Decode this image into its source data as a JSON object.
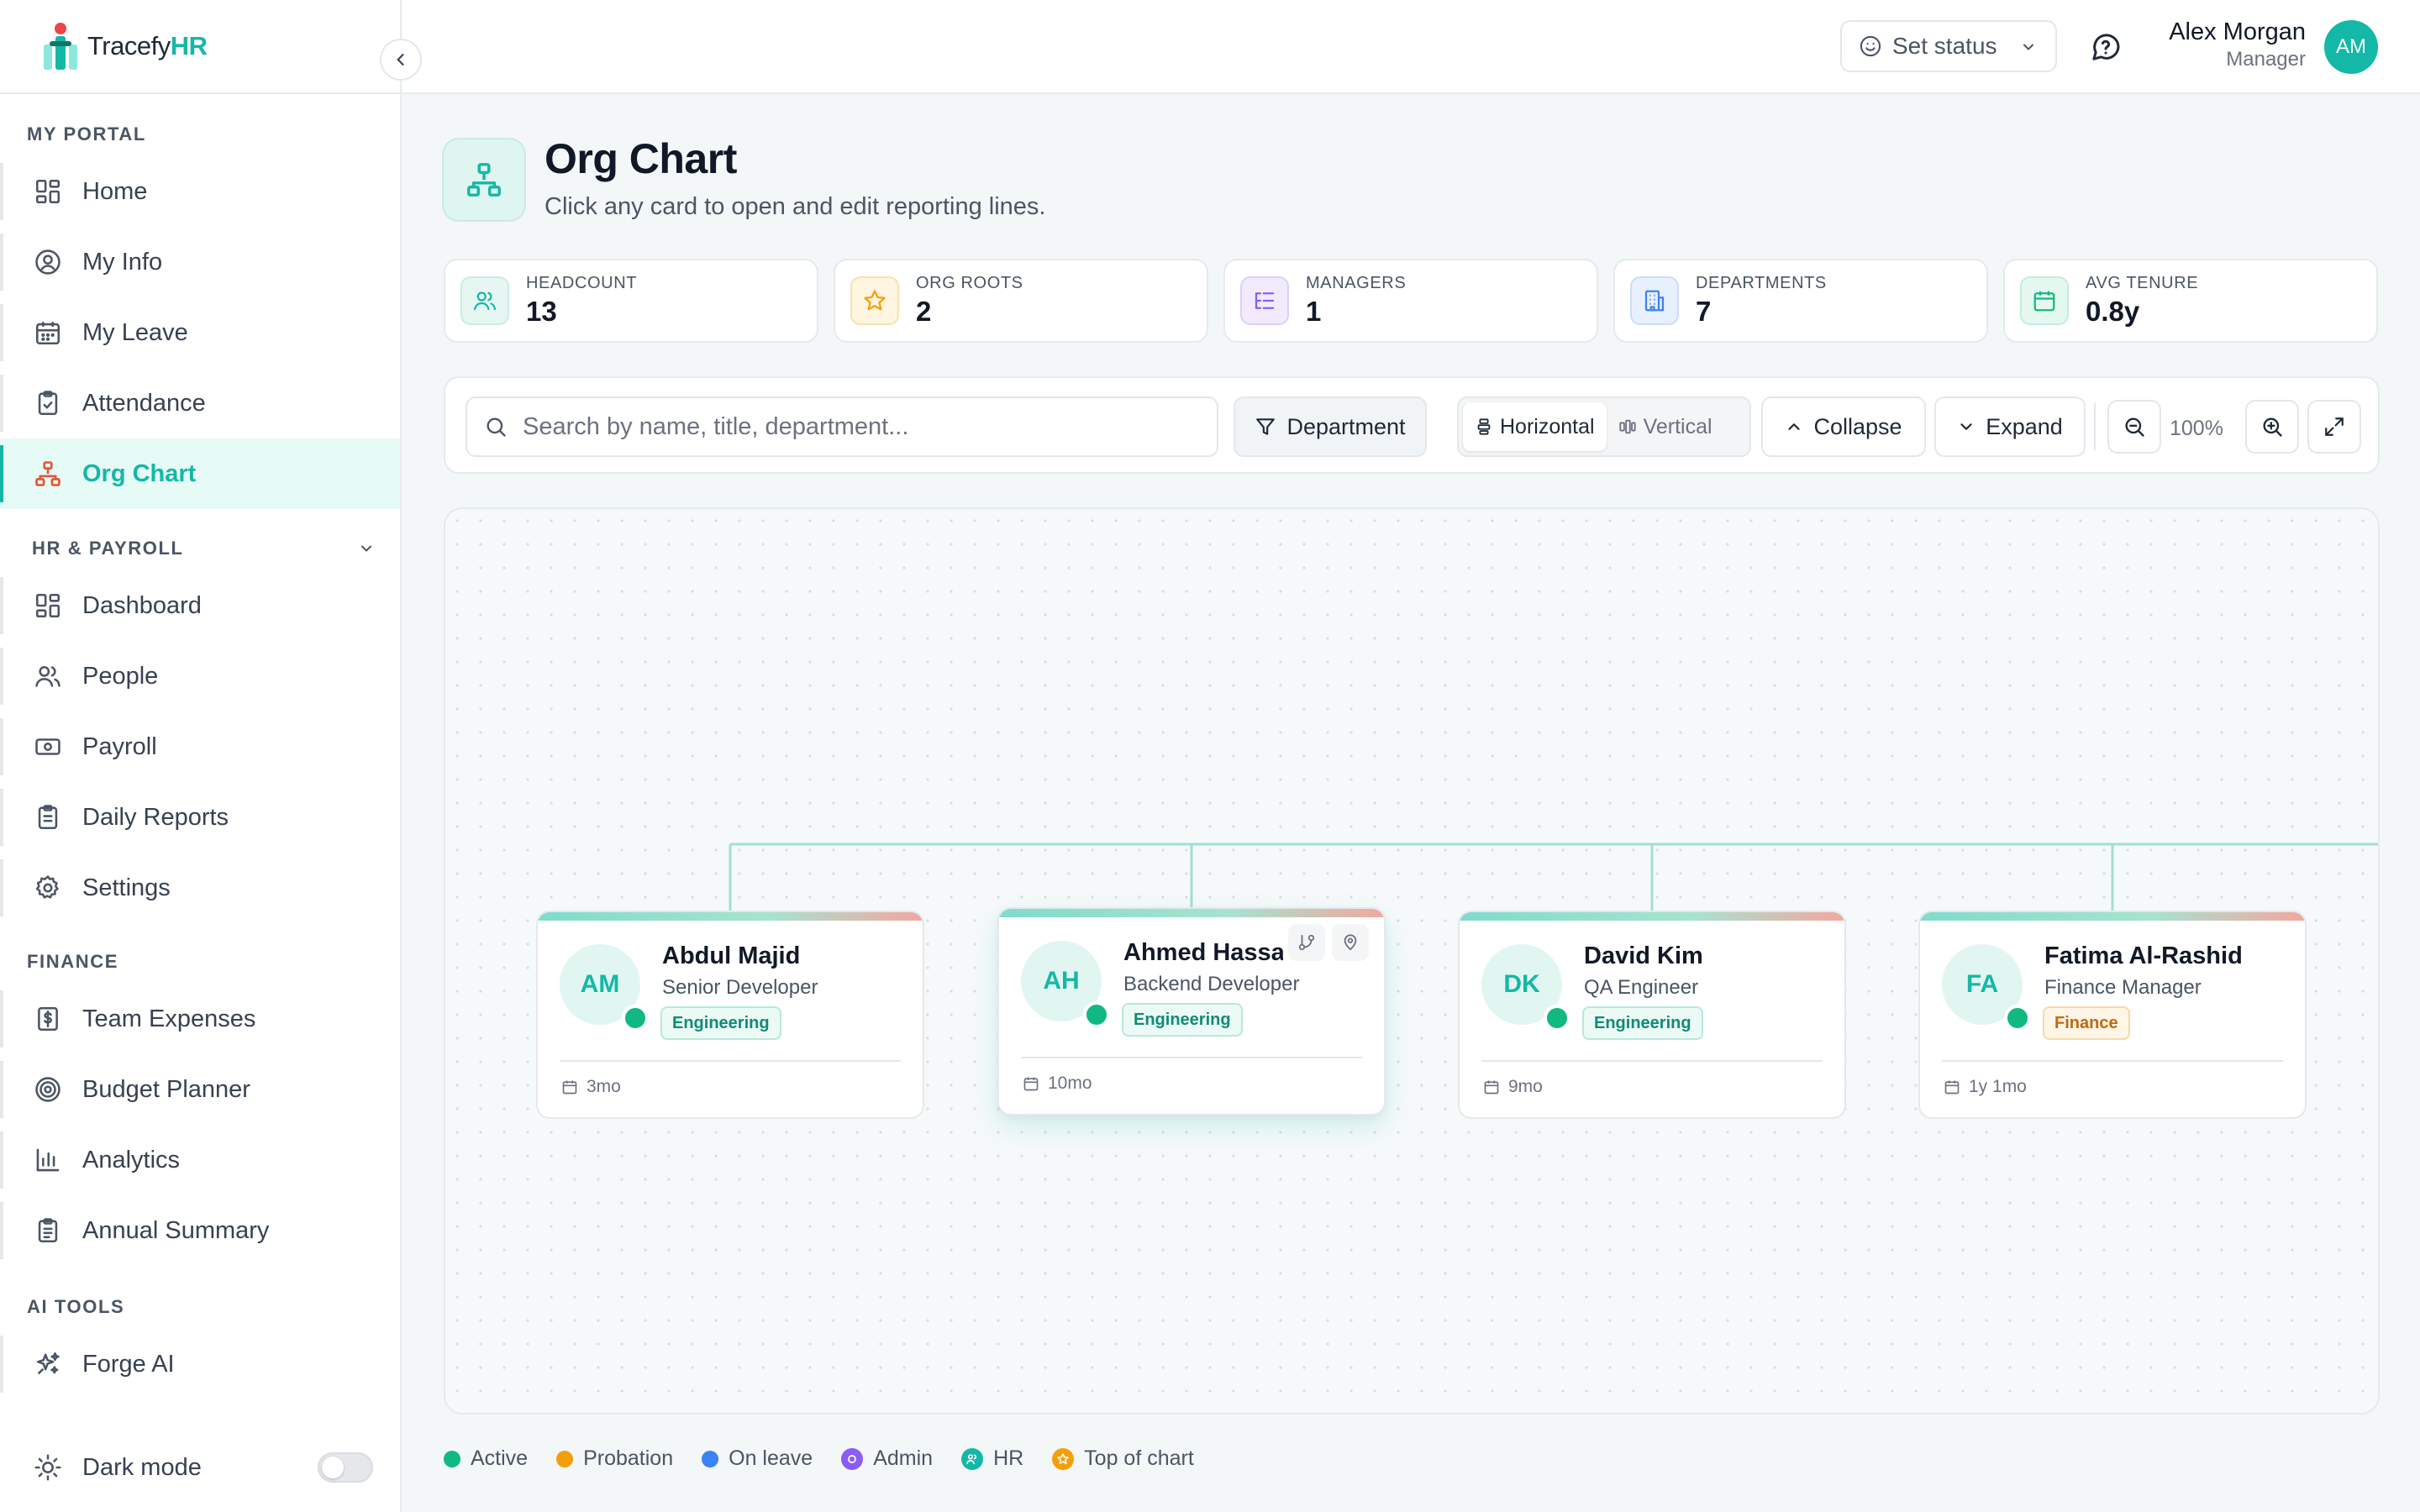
{
  "brand": {
    "name_part1": "Tracefy",
    "name_part2": "HR"
  },
  "sidebar": {
    "sections": [
      {
        "title": "MY PORTAL",
        "items": [
          {
            "label": "Home",
            "icon": "grid-icon"
          },
          {
            "label": "My Info",
            "icon": "user-circle-icon"
          },
          {
            "label": "My Leave",
            "icon": "calendar-icon"
          },
          {
            "label": "Attendance",
            "icon": "clipboard-check-icon"
          },
          {
            "label": "Org Chart",
            "icon": "org-chart-icon",
            "active": true
          }
        ]
      },
      {
        "title": "HR & PAYROLL",
        "items": [
          {
            "label": "Dashboard",
            "icon": "grid-icon"
          },
          {
            "label": "People",
            "icon": "users-icon"
          },
          {
            "label": "Payroll",
            "icon": "banknote-icon"
          },
          {
            "label": "Daily Reports",
            "icon": "clipboard-icon"
          },
          {
            "label": "Settings",
            "icon": "gear-icon"
          }
        ]
      },
      {
        "title": "FINANCE",
        "items": [
          {
            "label": "Team Expenses",
            "icon": "receipt-dollar-icon"
          },
          {
            "label": "Budget Planner",
            "icon": "target-icon"
          },
          {
            "label": "Analytics",
            "icon": "bar-chart-icon"
          },
          {
            "label": "Annual Summary",
            "icon": "clipboard-list-icon"
          }
        ]
      },
      {
        "title": "AI TOOLS",
        "items": [
          {
            "label": "Forge AI",
            "icon": "sparkles-icon"
          }
        ]
      }
    ],
    "dark_mode_label": "Dark mode"
  },
  "topbar": {
    "status_label": "Set status",
    "user_name": "Alex Morgan",
    "user_role": "Manager",
    "user_initials": "AM"
  },
  "page": {
    "title": "Org Chart",
    "subtitle": "Click any card to open and edit reporting lines."
  },
  "stats": [
    {
      "label": "HEADCOUNT",
      "value": "13",
      "icon": "users-icon",
      "color": "#14b8a6"
    },
    {
      "label": "ORG ROOTS",
      "value": "2",
      "icon": "star-icon",
      "color": "#f59e0b"
    },
    {
      "label": "MANAGERS",
      "value": "1",
      "icon": "hierarchy-list-icon",
      "color": "#8b5cf6"
    },
    {
      "label": "DEPARTMENTS",
      "value": "7",
      "icon": "building-icon",
      "color": "#3b82f6"
    },
    {
      "label": "AVG TENURE",
      "value": "0.8y",
      "icon": "calendar-icon",
      "color": "#10b981"
    }
  ],
  "toolbar": {
    "search_placeholder": "Search by name, title, department...",
    "department_label": "Department",
    "horizontal_label": "Horizontal",
    "vertical_label": "Vertical",
    "collapse_label": "Collapse",
    "expand_label": "Expand",
    "zoom_level": "100%"
  },
  "cards": [
    {
      "initials": "AM",
      "name": "Abdul Majid",
      "title": "Senior Developer",
      "department": "Engineering",
      "tenure": "3mo",
      "status": "Active"
    },
    {
      "initials": "AH",
      "name": "Ahmed Hassan",
      "title": "Backend Developer",
      "department": "Engineering",
      "tenure": "10mo",
      "status": "Active"
    },
    {
      "initials": "DK",
      "name": "David Kim",
      "title": "QA Engineer",
      "department": "Engineering",
      "tenure": "9mo",
      "status": "Active"
    },
    {
      "initials": "FA",
      "name": "Fatima Al-Rashid",
      "title": "Finance Manager",
      "department": "Finance",
      "tenure": "1y 1mo",
      "status": "Active"
    }
  ],
  "legend": [
    {
      "label": "Active",
      "color": "#10b981"
    },
    {
      "label": "Probation",
      "color": "#f59e0b"
    },
    {
      "label": "On leave",
      "color": "#3b82f6"
    },
    {
      "label": "Admin",
      "color": "#8b5cf6"
    },
    {
      "label": "HR",
      "color": "#14b8a6"
    },
    {
      "label": "Top of chart",
      "color": "#f59e0b"
    }
  ],
  "colors": {
    "accent": "#14b8a6",
    "active_status": "#10b981"
  }
}
